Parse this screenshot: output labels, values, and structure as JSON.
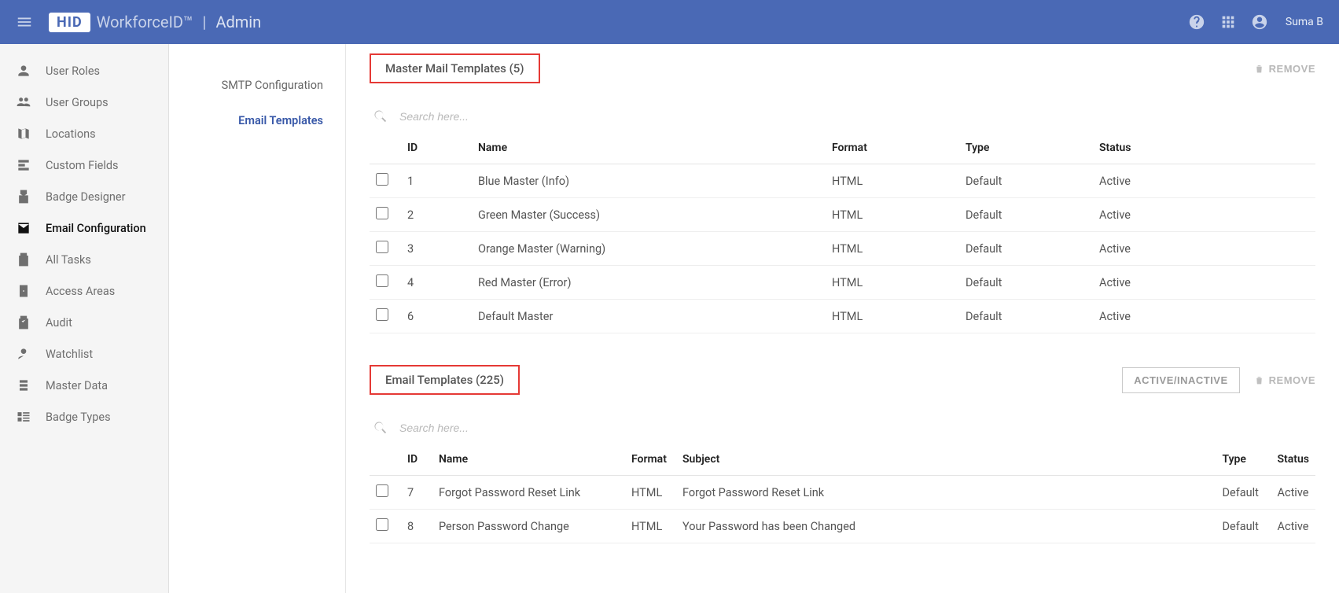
{
  "header": {
    "logo": "HID",
    "brand": "WorkforceID™",
    "section": "Admin",
    "user": "Suma B"
  },
  "sidebar": {
    "items": [
      {
        "icon": "person",
        "label": "User Roles"
      },
      {
        "icon": "group",
        "label": "User Groups"
      },
      {
        "icon": "map",
        "label": "Locations"
      },
      {
        "icon": "fields",
        "label": "Custom Fields"
      },
      {
        "icon": "badge",
        "label": "Badge Designer"
      },
      {
        "icon": "mail",
        "label": "Email Configuration",
        "active": true
      },
      {
        "icon": "tasks",
        "label": "All Tasks"
      },
      {
        "icon": "door",
        "label": "Access Areas"
      },
      {
        "icon": "audit",
        "label": "Audit"
      },
      {
        "icon": "watch",
        "label": "Watchlist"
      },
      {
        "icon": "data",
        "label": "Master Data"
      },
      {
        "icon": "types",
        "label": "Badge Types"
      }
    ]
  },
  "subnav": {
    "items": [
      {
        "label": "SMTP Configuration"
      },
      {
        "label": "Email Templates",
        "active": true
      }
    ]
  },
  "master": {
    "title": "Master Mail Templates (5)",
    "remove": "REMOVE",
    "search_placeholder": "Search here...",
    "columns": {
      "id": "ID",
      "name": "Name",
      "format": "Format",
      "type": "Type",
      "status": "Status"
    },
    "rows": [
      {
        "id": "1",
        "name": "Blue Master (Info)",
        "format": "HTML",
        "type": "Default",
        "status": "Active"
      },
      {
        "id": "2",
        "name": "Green Master (Success)",
        "format": "HTML",
        "type": "Default",
        "status": "Active"
      },
      {
        "id": "3",
        "name": "Orange Master (Warning)",
        "format": "HTML",
        "type": "Default",
        "status": "Active"
      },
      {
        "id": "4",
        "name": "Red Master (Error)",
        "format": "HTML",
        "type": "Default",
        "status": "Active"
      },
      {
        "id": "6",
        "name": "Default Master",
        "format": "HTML",
        "type": "Default",
        "status": "Active"
      }
    ]
  },
  "templates": {
    "title": "Email Templates (225)",
    "active_btn": "ACTIVE/INACTIVE",
    "remove": "REMOVE",
    "search_placeholder": "Search here...",
    "columns": {
      "id": "ID",
      "name": "Name",
      "format": "Format",
      "subject": "Subject",
      "type": "Type",
      "status": "Status"
    },
    "rows": [
      {
        "id": "7",
        "name": "Forgot Password Reset Link",
        "format": "HTML",
        "subject": "Forgot Password Reset Link",
        "type": "Default",
        "status": "Active"
      },
      {
        "id": "8",
        "name": "Person Password Change",
        "format": "HTML",
        "subject": "Your Password has been Changed",
        "type": "Default",
        "status": "Active"
      }
    ]
  }
}
